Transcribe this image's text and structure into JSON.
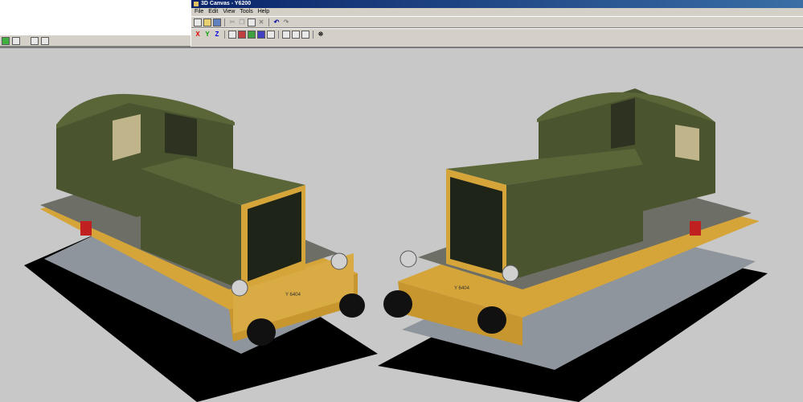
{
  "window": {
    "title": "3D Canvas - Y6200"
  },
  "menu": {
    "file": "File",
    "edit": "Edit",
    "view": "View",
    "tools": "Tools",
    "help": "Help"
  },
  "toolbar": {
    "x_axis": "X",
    "y_axis": "Y",
    "z_axis": "Z"
  },
  "viewport": {
    "plate_number_left": "Y 6404",
    "plate_number_right": "Y 6404",
    "colors": {
      "body": "#4a5530",
      "trim": "#d6a53a",
      "chassis": "#9aa0a8",
      "shadow": "#000000",
      "background": "#c8c8c8"
    }
  }
}
